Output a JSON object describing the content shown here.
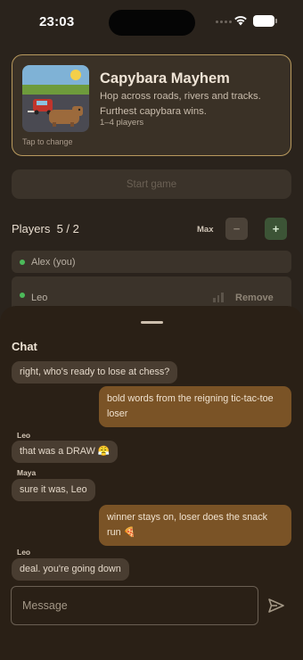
{
  "status_bar": {
    "time": "23:03"
  },
  "game": {
    "title": "Capybara Mayhem",
    "description": "Hop across roads, rivers and tracks. Furthest capybara wins.",
    "players": "1–4 players",
    "tap_to_change": "Tap to change"
  },
  "start_button": "Start game",
  "players": {
    "heading": "Players  5 / 2",
    "max_label": "Max",
    "minus_label": "−",
    "plus_label": "+",
    "list": [
      {
        "name": "Alex (you)"
      },
      {
        "name": "Leo",
        "action": "Remove"
      }
    ]
  },
  "chat": {
    "title": "Chat",
    "messages": [
      {
        "text": "right, who's ready to lose at chess?"
      },
      {
        "text": "bold words from the reigning tic-tac-toe loser"
      },
      {
        "sender": "Leo",
        "text": "that was a DRAW 😤"
      },
      {
        "sender": "Maya",
        "text": "sure it was, Leo"
      },
      {
        "text": "winner stays on, loser does the snack run 🍕"
      },
      {
        "sender": "Leo",
        "text": "deal. you're going down"
      }
    ],
    "input_placeholder": "Message"
  },
  "colors": {
    "background": "#2a231c",
    "accent_border": "#b99a5e",
    "own_bubble": "#7a5326",
    "other_bubble": "#493d31",
    "online_dot": "#4cba5a"
  }
}
